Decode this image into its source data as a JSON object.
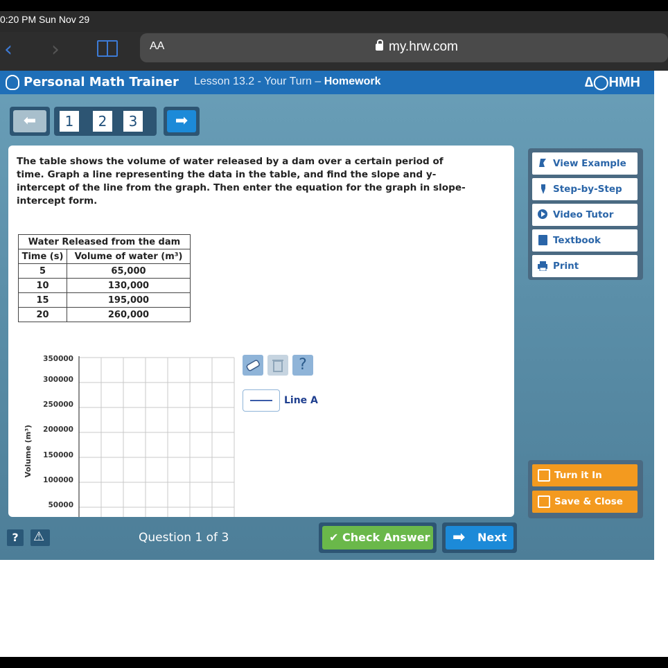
{
  "status": {
    "time": "0:20 PM  Sun Nov 29"
  },
  "browser": {
    "aa_label": "AA",
    "url": "my.hrw.com"
  },
  "header": {
    "brand": "Personal Math Trainer",
    "lesson": "Lesson 13.2 - Your Turn –",
    "assignment": "Homework",
    "publisher": "∆◯HMH"
  },
  "nav": {
    "questions": [
      "1",
      "2",
      "3"
    ]
  },
  "prompt": "The table shows the volume of water released by a dam over a certain period of time. Graph a line representing the data in the table, and find the slope and y-intercept of the line from the graph. Then enter the equation for the graph in slope-intercept form.",
  "table": {
    "caption": "Water Released from the dam",
    "col_time": "Time (s)",
    "col_volume": "Volume of water (m³)",
    "rows": [
      {
        "time": "5",
        "volume": "65,000"
      },
      {
        "time": "10",
        "volume": "130,000"
      },
      {
        "time": "15",
        "volume": "195,000"
      },
      {
        "time": "20",
        "volume": "260,000"
      }
    ]
  },
  "graph": {
    "ylabel": "Volume (m³)",
    "y_ticks": [
      "350000",
      "300000",
      "250000",
      "200000",
      "150000",
      "100000",
      "50000"
    ]
  },
  "tools": {
    "help": "?",
    "line_label": "Line A"
  },
  "side": {
    "items": [
      "View Example",
      "Step-by-Step",
      "Video Tutor",
      "Textbook",
      "Print"
    ],
    "turn_in": "Turn it In",
    "save_close": "Save & Close"
  },
  "footer": {
    "help": "?",
    "question_count": "Question 1 of 3",
    "check": "✔ Check Answer",
    "next": "Next"
  },
  "colors": {
    "header_blue": "#1f6fb8",
    "check_green": "#6ab84a",
    "turnin_orange": "#f39a1f"
  }
}
